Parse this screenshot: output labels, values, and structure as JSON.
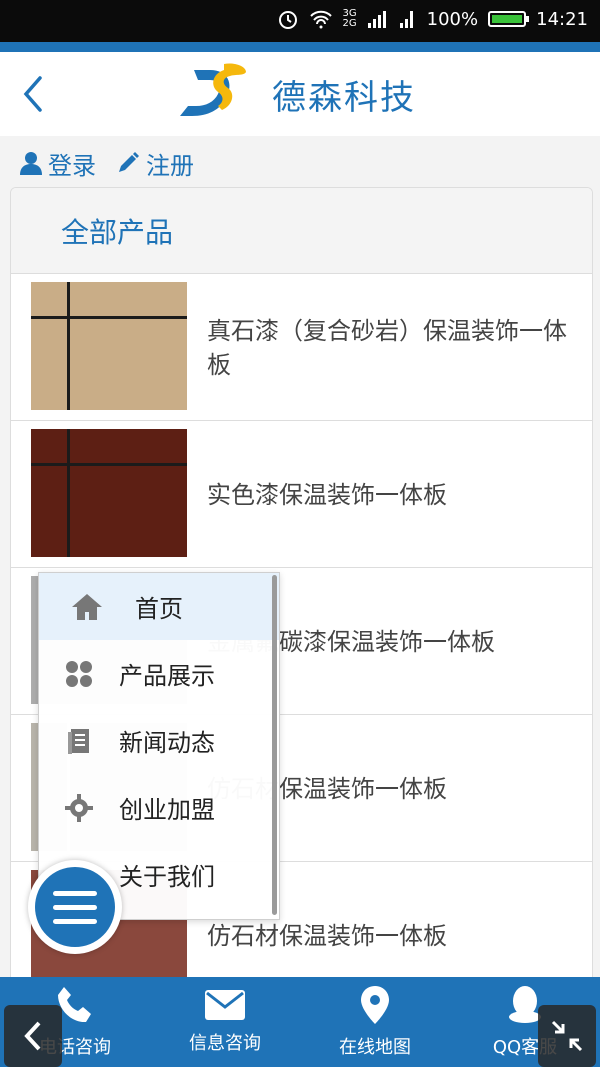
{
  "status_bar": {
    "network_small_top": "3G",
    "network_small_bottom": "2G",
    "battery": "100%",
    "time": "14:21"
  },
  "header": {
    "title": "德森科技"
  },
  "auth": {
    "login": "登录",
    "register": "注册"
  },
  "products": {
    "heading": "全部产品",
    "items": [
      {
        "name": "真石漆（复合砂岩）保温装饰一体板"
      },
      {
        "name": "实色漆保温装饰一体板"
      },
      {
        "name": "金属氟碳漆保温装饰一体板"
      },
      {
        "name": "仿石材保温装饰一体板"
      },
      {
        "name": "仿石材保温装饰一体板"
      }
    ]
  },
  "menu": {
    "items": [
      {
        "label": "首页",
        "icon": "home-icon"
      },
      {
        "label": "产品展示",
        "icon": "grid-icon"
      },
      {
        "label": "新闻动态",
        "icon": "news-icon"
      },
      {
        "label": "创业加盟",
        "icon": "gear-icon"
      },
      {
        "label": "关于我们",
        "icon": "info-icon"
      }
    ]
  },
  "bottom_nav": {
    "items": [
      {
        "label": "电话咨询",
        "icon": "phone-icon"
      },
      {
        "label": "信息咨询",
        "icon": "mail-icon"
      },
      {
        "label": "在线地图",
        "icon": "map-pin-icon"
      },
      {
        "label": "QQ客服",
        "icon": "qq-icon"
      }
    ]
  },
  "colors": {
    "brand_blue": "#1f73b7",
    "logo_yellow": "#f5b80d"
  }
}
